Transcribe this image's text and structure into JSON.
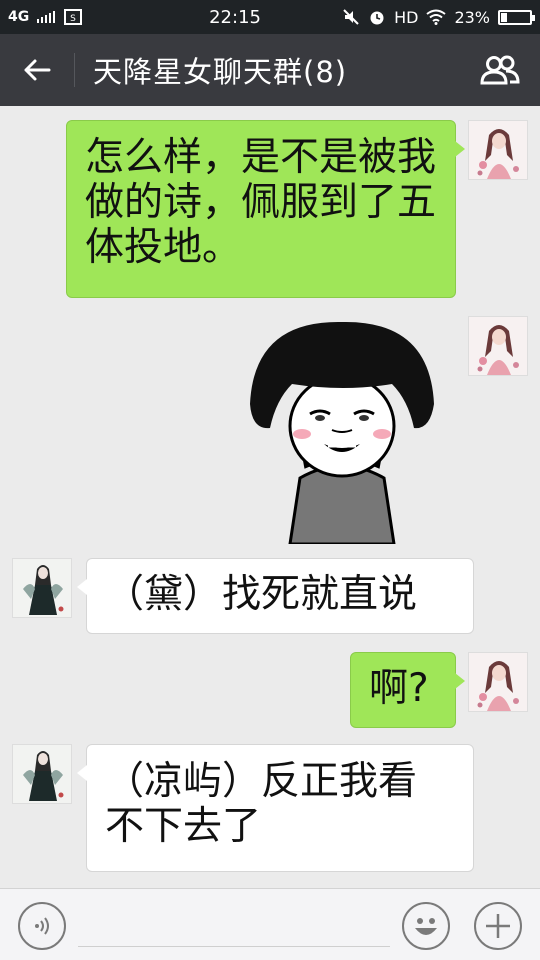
{
  "status_bar": {
    "network": "4G",
    "time": "22:15",
    "hd": "HD",
    "battery_percent": "23%",
    "battery_level": 0.23
  },
  "header": {
    "title": "天降星女聊天群(8)",
    "back_icon": "arrow-left-icon",
    "members_icon": "group-members-icon"
  },
  "messages": [
    {
      "sender": "me",
      "type": "text",
      "text": "怎么样，是不是被我做的诗，佩服到了五体投地。"
    },
    {
      "sender": "me",
      "type": "sticker",
      "sticker": "mushroom-head-meme-sticker"
    },
    {
      "sender": "other",
      "type": "text",
      "text": "（黛）找死就直说"
    },
    {
      "sender": "me",
      "type": "text",
      "text": "啊?"
    },
    {
      "sender": "other",
      "type": "text",
      "text": "（凉屿）反正我看不下去了"
    }
  ],
  "input_bar": {
    "voice_icon": "voice-icon",
    "emoji_icon": "emoji-icon",
    "plus_icon": "plus-icon"
  },
  "colors": {
    "my_bubble": "#9fe658",
    "other_bubble": "#ffffff",
    "header_bg": "#393a3f",
    "chat_bg": "#ebebeb"
  }
}
